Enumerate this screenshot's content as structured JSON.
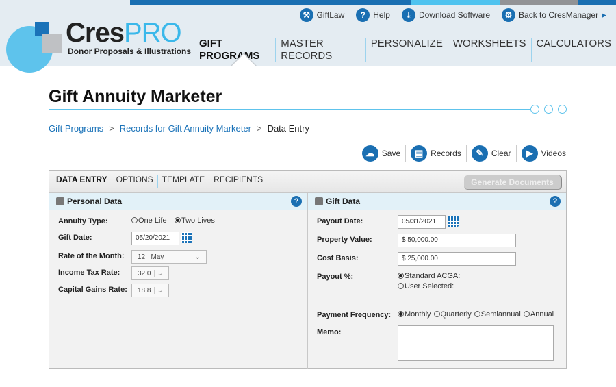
{
  "logo": {
    "name_a": "Cres",
    "name_b": "PRO",
    "subtitle": "Donor Proposals & Illustrations"
  },
  "top_links": [
    {
      "label": "GiftLaw",
      "icon": "gavel-icon"
    },
    {
      "label": "Help",
      "icon": "help-icon"
    },
    {
      "label": "Download Software",
      "icon": "download-icon"
    },
    {
      "label": "Back to CresManager",
      "icon": "gears-icon"
    }
  ],
  "main_nav": [
    "GIFT PROGRAMS",
    "MASTER RECORDS",
    "PERSONALIZE",
    "WORKSHEETS",
    "CALCULATORS"
  ],
  "page_title": "Gift Annuity Marketer",
  "breadcrumb": {
    "items": [
      "Gift Programs",
      "Records for Gift Annuity Marketer"
    ],
    "current": "Data Entry",
    "sep": ">"
  },
  "toolbar": [
    {
      "label": "Save",
      "icon": "cloud-save-icon"
    },
    {
      "label": "Records",
      "icon": "document-icon"
    },
    {
      "label": "Clear",
      "icon": "eraser-icon"
    },
    {
      "label": "Videos",
      "icon": "video-icon"
    }
  ],
  "tabs": [
    "DATA ENTRY",
    "OPTIONS",
    "TEMPLATE",
    "RECIPIENTS"
  ],
  "generate_label": "Generate Documents",
  "personal": {
    "title": "Personal Data",
    "annuity_type_label": "Annuity Type:",
    "annuity_options": [
      "One Life",
      "Two Lives"
    ],
    "gift_date_label": "Gift Date:",
    "gift_date": "05/20/2021",
    "rate_label": "Rate of the Month:",
    "rate_value": "12   May",
    "income_tax_label": "Income Tax Rate:",
    "income_tax": "32.0",
    "cap_gains_label": "Capital Gains Rate:",
    "cap_gains": "18.8"
  },
  "gift": {
    "title": "Gift Data",
    "payout_date_label": "Payout Date:",
    "payout_date": "05/31/2021",
    "property_value_label": "Property Value:",
    "property_value": "$ 50,000.00",
    "cost_basis_label": "Cost Basis:",
    "cost_basis": "$ 25,000.00",
    "payout_pct_label": "Payout %:",
    "payout_options": [
      "Standard ACGA:",
      "User Selected:"
    ],
    "frequency_label": "Payment Frequency:",
    "frequency_options": [
      "Monthly",
      "Quarterly",
      "Semiannual",
      "Annual"
    ],
    "memo_label": "Memo:",
    "memo": ""
  },
  "help_glyph": "?"
}
